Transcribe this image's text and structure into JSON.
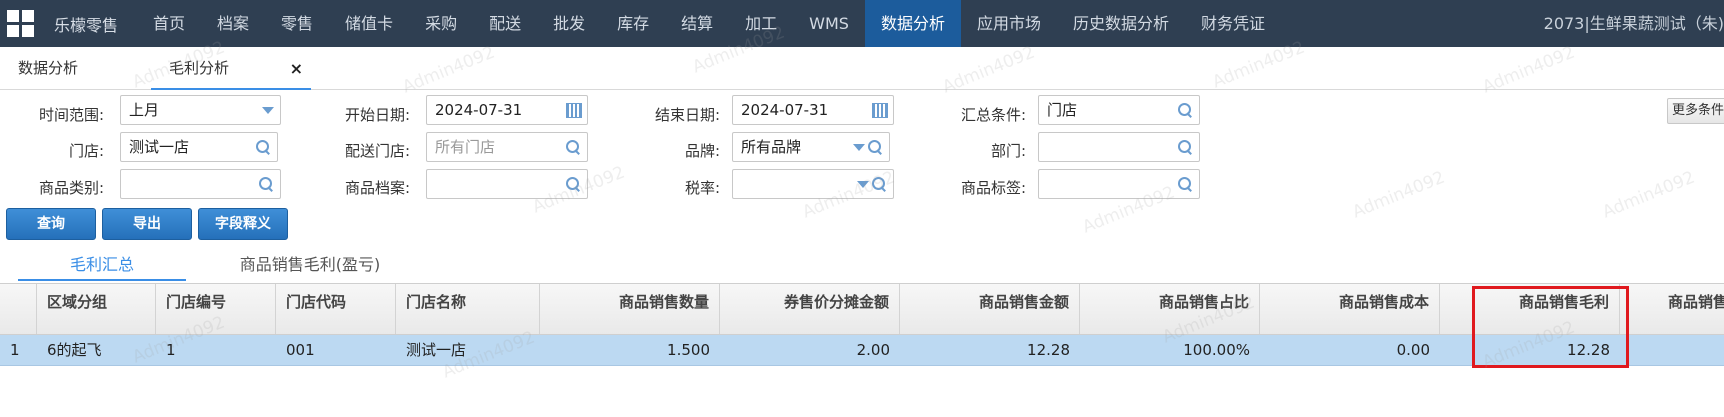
{
  "nav": {
    "brand": "乐檬零售",
    "items": [
      {
        "label": "首页",
        "active": false
      },
      {
        "label": "档案",
        "active": false
      },
      {
        "label": "零售",
        "active": false
      },
      {
        "label": "储值卡",
        "active": false
      },
      {
        "label": "采购",
        "active": false
      },
      {
        "label": "配送",
        "active": false
      },
      {
        "label": "批发",
        "active": false
      },
      {
        "label": "库存",
        "active": false
      },
      {
        "label": "结算",
        "active": false
      },
      {
        "label": "加工",
        "active": false
      },
      {
        "label": "WMS",
        "active": false
      },
      {
        "label": "数据分析",
        "active": true
      },
      {
        "label": "应用市场",
        "active": false
      },
      {
        "label": "历史数据分析",
        "active": false
      },
      {
        "label": "财务凭证",
        "active": false
      }
    ],
    "user": "2073|生鲜果蔬测试（朱)"
  },
  "tabs": {
    "tab1": "数据分析",
    "tab2": "毛利分析",
    "close": "×"
  },
  "filters": {
    "time_range_label": "时间范围:",
    "time_range_value": "上月",
    "start_date_label": "开始日期:",
    "start_date_value": "2024-07-31",
    "end_date_label": "结束日期:",
    "end_date_value": "2024-07-31",
    "summary_label": "汇总条件:",
    "summary_value": "门店",
    "more_label": "更多条件",
    "store_label": "门店:",
    "store_value": "测试一店",
    "delivery_store_label": "配送门店:",
    "delivery_store_placeholder": "所有门店",
    "brand_label": "品牌:",
    "brand_value": "所有品牌",
    "dept_label": "部门:",
    "dept_value": "",
    "category_label": "商品类别:",
    "category_value": "",
    "archive_label": "商品档案:",
    "archive_value": "",
    "tax_label": "税率:",
    "tax_value": "",
    "tag_label": "商品标签:",
    "tag_value": ""
  },
  "buttons": {
    "query": "查询",
    "export": "导出",
    "field_def": "字段释义"
  },
  "subtabs": {
    "summary": "毛利汇总",
    "product_profit": "商品销售毛利(盈亏)"
  },
  "table": {
    "headers": [
      "区域分组",
      "门店编号",
      "门店代码",
      "门店名称",
      "商品销售数量",
      "券售价分摊金额",
      "商品销售金额",
      "商品销售占比",
      "商品销售成本",
      "商品销售毛利",
      "商品销售"
    ],
    "row": {
      "index": "1",
      "cells": [
        "6的起飞",
        "1",
        "001",
        "测试一店",
        "1.500",
        "2.00",
        "12.28",
        "100.00%",
        "0.00",
        "12.28",
        ""
      ]
    }
  },
  "watermark": "Admin4092"
}
